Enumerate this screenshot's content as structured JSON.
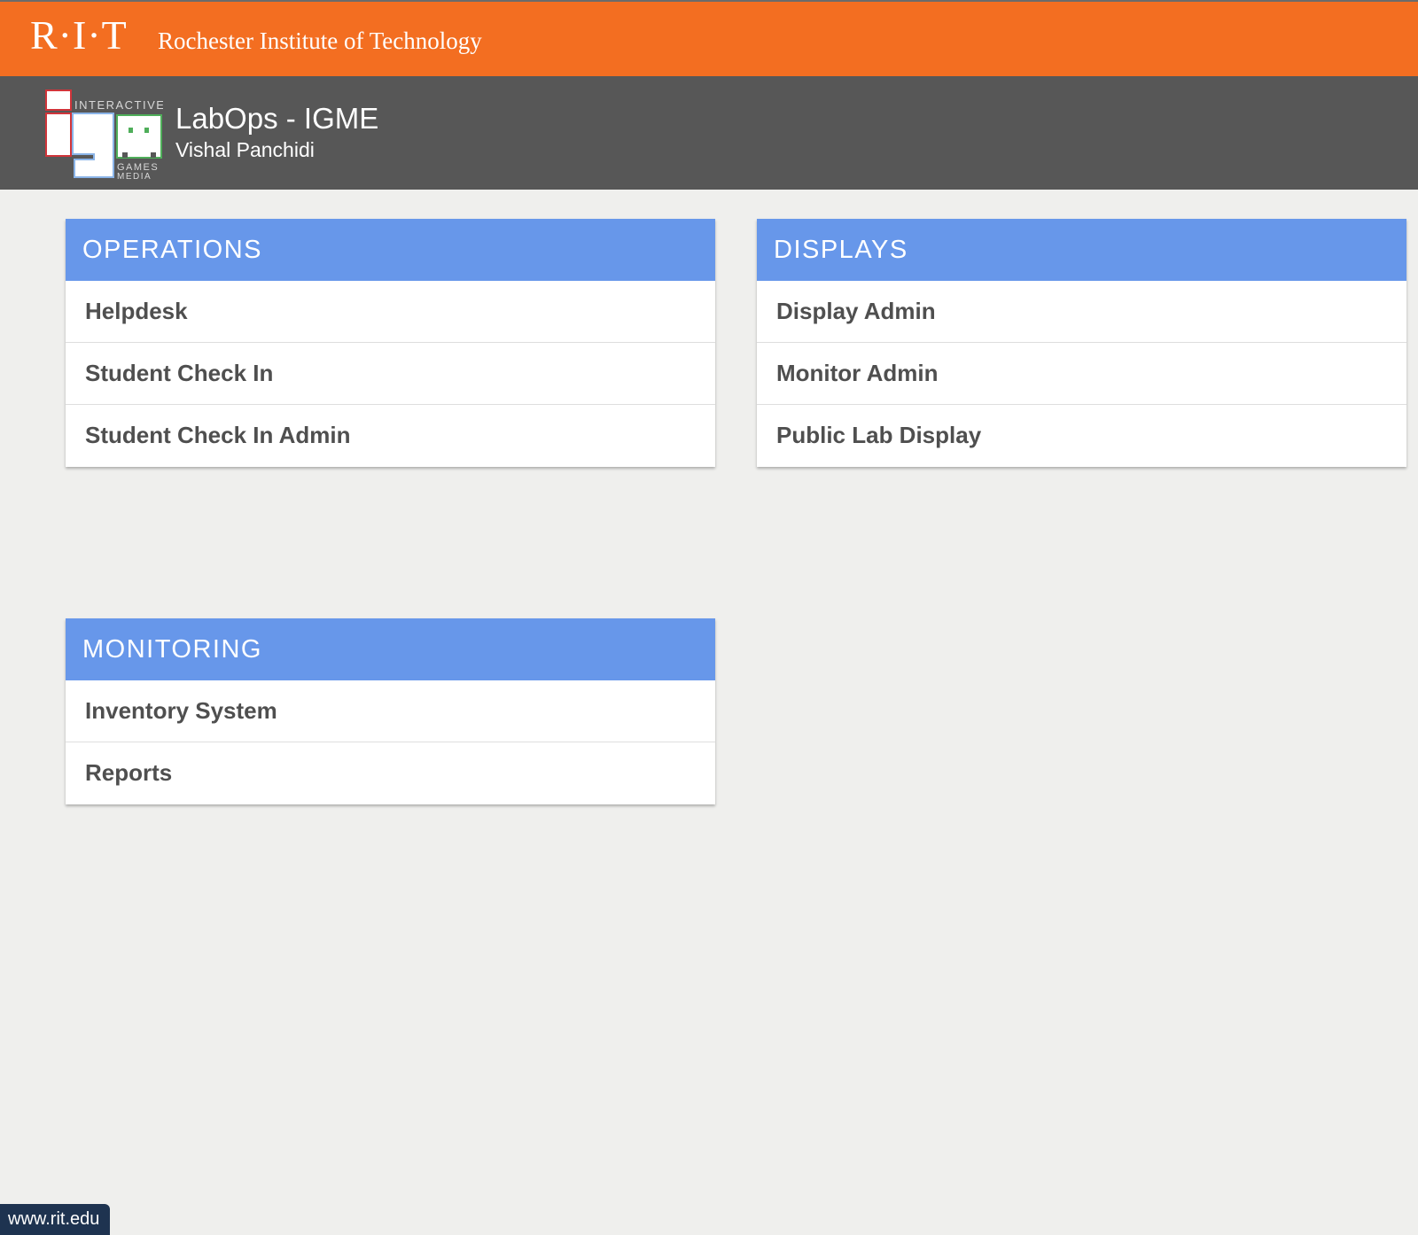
{
  "rit_bar": {
    "logo": "R·I·T",
    "name": "Rochester Institute of Technology",
    "color": "#f36e21"
  },
  "header": {
    "logo_text_top": "INTERACTIVE",
    "logo_text_bottom": "GAMES",
    "logo_text_media": "MEDIA",
    "title": "LabOps - IGME",
    "user": "Vishal Panchidi",
    "color": "#575757"
  },
  "sections": {
    "operations": {
      "title": "OPERATIONS",
      "items": [
        "Helpdesk",
        "Student Check In",
        "Student Check In Admin"
      ]
    },
    "displays": {
      "title": "DISPLAYS",
      "items": [
        "Display Admin",
        "Monitor Admin",
        "Public Lab Display"
      ]
    },
    "monitoring": {
      "title": "MONITORING",
      "items": [
        "Inventory System",
        "Reports"
      ]
    }
  },
  "status_bar": {
    "url": "www.rit.edu"
  },
  "colors": {
    "card_header": "#6797ea",
    "background": "#efefed",
    "item_text": "#4f4f4f"
  }
}
